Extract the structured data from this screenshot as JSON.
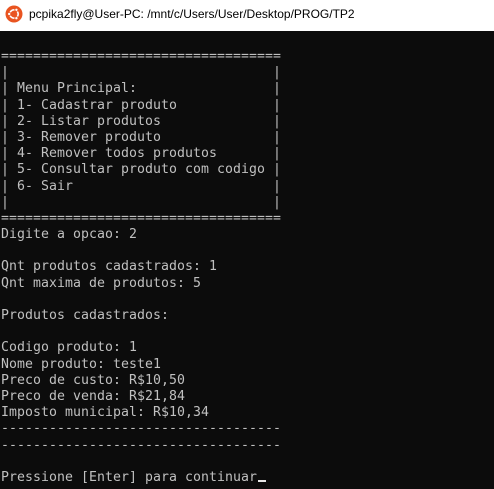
{
  "window": {
    "title": "pcpika2fly@User-PC: /mnt/c/Users/User/Desktop/PROG/TP2",
    "icon": "ubuntu-icon",
    "colors": {
      "titlebar": "#ffffff",
      "terminal_bg": "#0c0c0c",
      "terminal_fg": "#c0c0c0",
      "icon": "#e95420"
    }
  },
  "terminal": {
    "lines": [
      "===================================",
      "|                                 |",
      "| Menu Principal:                 |",
      "| 1- Cadastrar produto            |",
      "| 2- Listar produtos              |",
      "| 3- Remover produto              |",
      "| 4- Remover todos produtos       |",
      "| 5- Consultar produto com codigo |",
      "| 6- Sair                         |",
      "|                                 |",
      "===================================",
      "Digite a opcao: 2",
      "",
      "Qnt produtos cadastrados: 1",
      "Qnt maxima de produtos: 5",
      "",
      "Produtos cadastrados:",
      "",
      "Codigo produto: 1",
      "Nome produto: teste1",
      "Preco de custo: R$10,50",
      "Preco de venda: R$21,84",
      "Imposto municipal: R$10,34",
      "-----------------------------------",
      "-----------------------------------",
      "",
      "Pressione [Enter] para continuar"
    ]
  }
}
